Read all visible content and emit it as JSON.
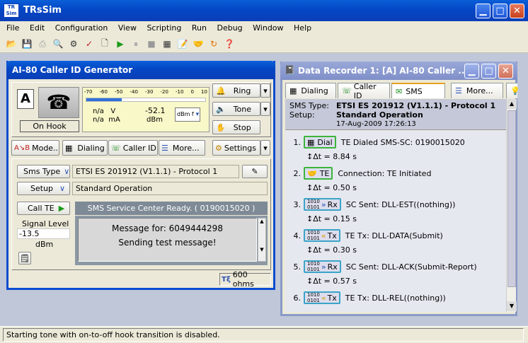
{
  "app": {
    "title": "TRsSim",
    "logo": "TR Sim"
  },
  "menu": [
    "File",
    "Edit",
    "Configuration",
    "View",
    "Scripting",
    "Run",
    "Debug",
    "Window",
    "Help"
  ],
  "toolbar_icons": [
    "open-icon",
    "save-icon",
    "print-icon",
    "print-preview-icon",
    "settings-gear-icon",
    "checklist-icon",
    "new-document-icon",
    "run-icon",
    "pause-icon",
    "stop-icon",
    "grid-icon",
    "notes-icon",
    "handshake-icon",
    "refresh-icon",
    "help-icon"
  ],
  "generator": {
    "title": "AI-80  Caller ID Generator",
    "line_letter": "A",
    "hook_status": "On Hook",
    "meter": {
      "scale": [
        "-70",
        "-60",
        "-50",
        "-40",
        "-30",
        "-20",
        "-10",
        "0",
        "10"
      ],
      "level_fraction": 0.3,
      "v_label": "n/a",
      "v_unit": "V",
      "ma_label": "n/a",
      "ma_unit": "mA",
      "dbm_value": "-52.1",
      "dbm_unit": "dBm",
      "dbf_label": "dBm f"
    },
    "ring_label": "Ring",
    "tone_label": "Tone",
    "stop_label": "Stop",
    "mode_label": "Mode...",
    "tabs": [
      "Dialing",
      "Caller ID",
      "More..."
    ],
    "settings_label": "Settings",
    "sms_type_label": "Sms Type",
    "sms_type_value": "ETSI ES 201912 (V1.1.1) - Protocol 1",
    "setup_label": "Setup",
    "setup_value": "Standard Operation",
    "call_te_label": "Call TE",
    "signal_level_label": "Signal Level",
    "signal_level_value": "-13.5",
    "signal_level_unit": "dBm",
    "status_banner": "SMS Service Center Ready.  ( 0190015020 )",
    "message_line1": "Message for:  6049444298",
    "message_line2": "Sending test message!",
    "impedance": "600 ohms"
  },
  "recorder": {
    "title": "Data Recorder 1:  [A] AI-80  Caller ...",
    "tabs": [
      "Dialing",
      "Caller ID",
      "SMS",
      "More..."
    ],
    "active_tab": "SMS",
    "sms_type_label": "SMS Type:",
    "sms_type_value": "ETSI ES 201912 (V1.1.1) - Protocol 1",
    "setup_label": "Setup:",
    "setup_value": "Standard Operation",
    "timestamp": "17-Aug-2009  17:26:13",
    "events": [
      {
        "num": "1.",
        "badge": "Dial",
        "badge_style": "green",
        "text": "TE Dialed SMS-SC:  0190015020",
        "delta": "Δt = 8.84 s"
      },
      {
        "num": "2.",
        "badge": "TE",
        "badge_style": "green",
        "text": "Connection:  TE Initiated",
        "delta": "Δt = 0.50 s"
      },
      {
        "num": "3.",
        "badge": "Rx",
        "badge_style": "blue",
        "text": "SC Sent: DLL-EST((nothing))",
        "delta": "Δt = 0.15 s"
      },
      {
        "num": "4.",
        "badge": "Tx",
        "badge_style": "blue",
        "text": "TE Tx: DLL-DATA(Submit)",
        "delta": "Δt = 0.30 s"
      },
      {
        "num": "5.",
        "badge": "Rx",
        "badge_style": "blue",
        "text": "SC Sent: DLL-ACK(Submit-Report)",
        "delta": "Δt = 0.57 s"
      },
      {
        "num": "6.",
        "badge": "Tx",
        "badge_style": "blue",
        "text": "TE Tx: DLL-REL((nothing))",
        "delta": ""
      }
    ]
  },
  "statusbar": "Starting tone with on-to-off hook transition is disabled."
}
